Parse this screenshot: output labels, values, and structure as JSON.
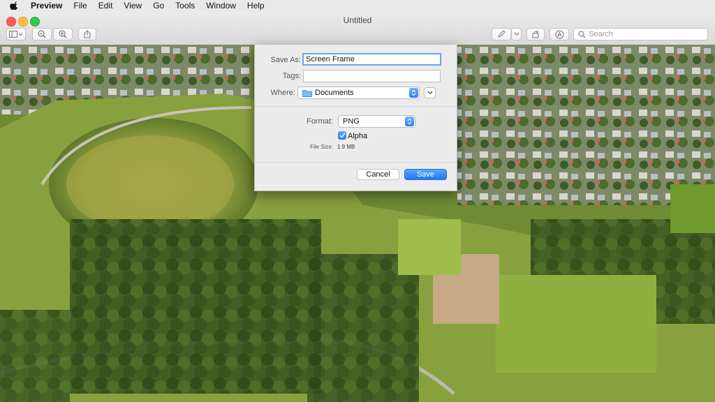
{
  "menubar": {
    "items": [
      "Preview",
      "File",
      "Edit",
      "View",
      "Go",
      "Tools",
      "Window",
      "Help"
    ]
  },
  "window": {
    "title": "Untitled"
  },
  "toolbar": {
    "search_placeholder": "Search",
    "icons": [
      "sidebar-icon",
      "zoom-out-icon",
      "zoom-in-icon",
      "share-icon",
      "markup-pen-icon",
      "chevron-down-icon",
      "rotate-icon",
      "annotate-icon",
      "search-icon"
    ]
  },
  "save_dialog": {
    "save_as_label": "Save As:",
    "save_as_value": "Screen Frame",
    "tags_label": "Tags:",
    "tags_value": "",
    "where_label": "Where:",
    "where_value": "Documents",
    "format_label": "Format:",
    "format_value": "PNG",
    "alpha_label": "Alpha",
    "alpha_checked": true,
    "file_size_label": "File Size:",
    "file_size_value": "1.9 MB",
    "cancel_label": "Cancel",
    "save_label": "Save"
  },
  "colors": {
    "accent": "#2a7cf6",
    "folder": "#5aa9e6"
  }
}
